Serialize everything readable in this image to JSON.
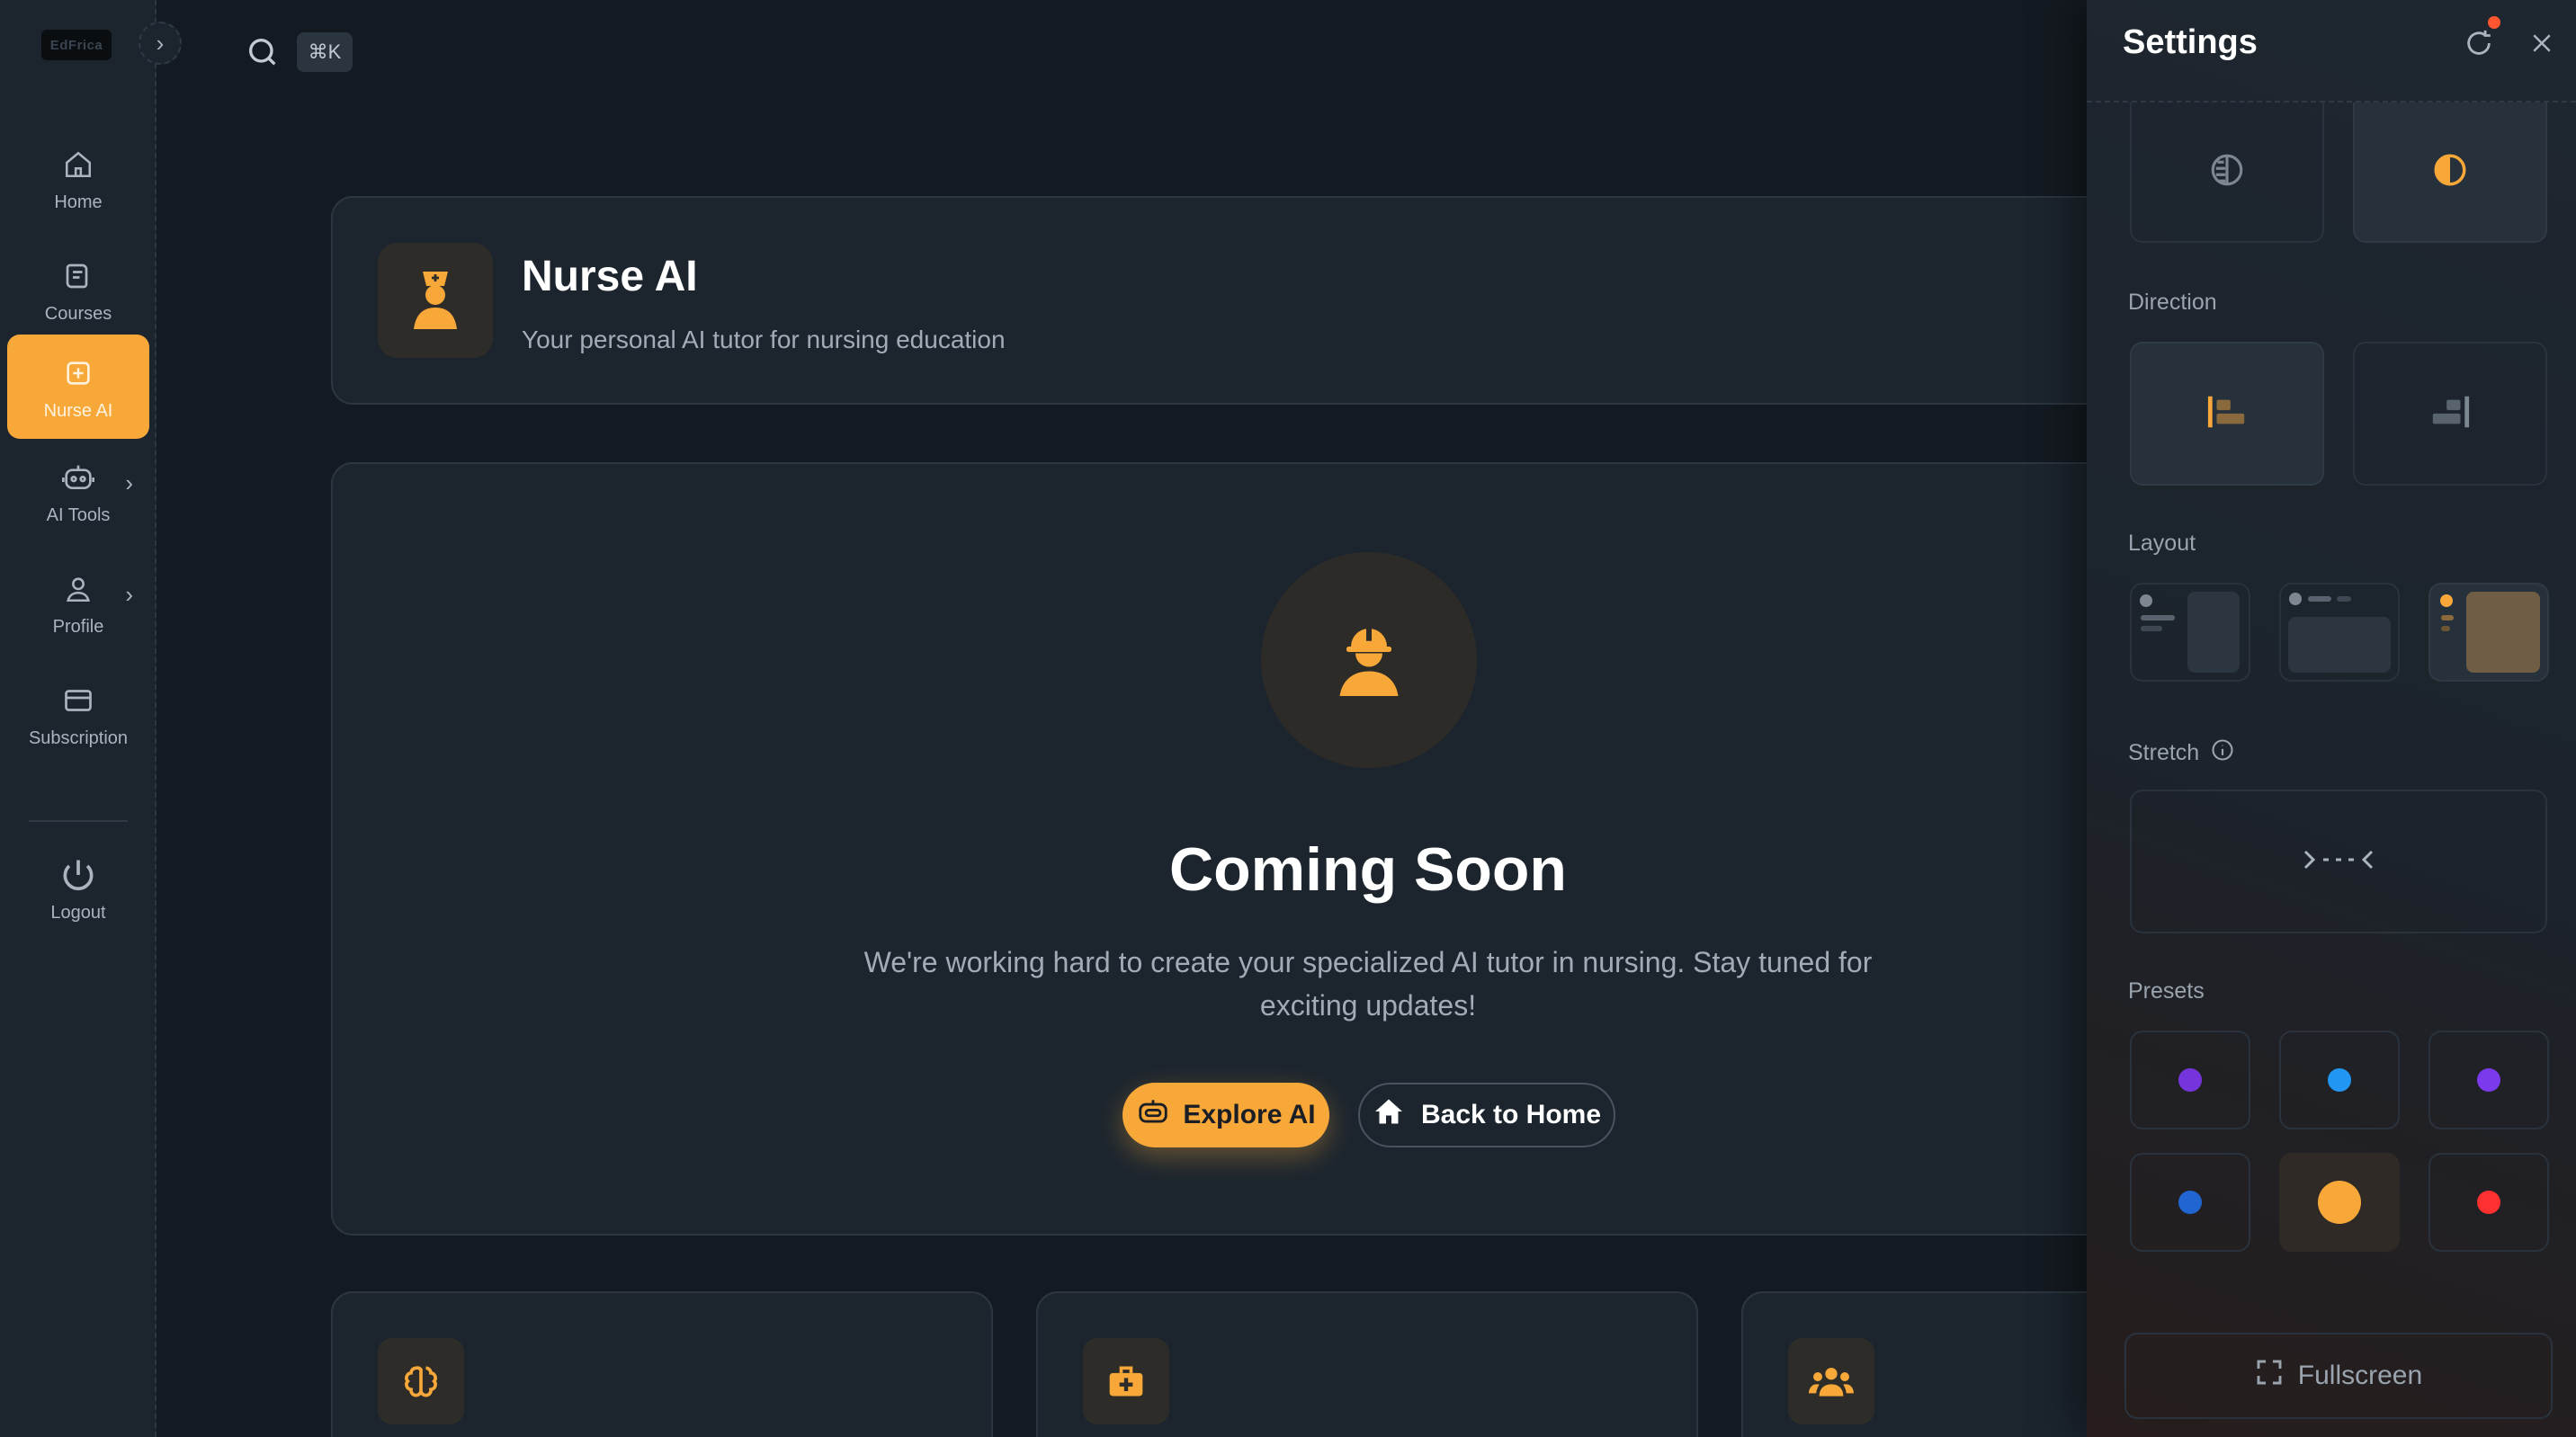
{
  "sidebar": {
    "logo_text": "EdFrica",
    "items": [
      {
        "label": "Home"
      },
      {
        "label": "Courses"
      },
      {
        "label": "Nurse AI"
      },
      {
        "label": "AI Tools"
      },
      {
        "label": "Profile"
      },
      {
        "label": "Subscription"
      },
      {
        "label": "Logout"
      }
    ]
  },
  "topbar": {
    "shortcut": "⌘K"
  },
  "header": {
    "title": "Nurse AI",
    "subtitle": "Your personal AI tutor for nursing education"
  },
  "main": {
    "title": "Coming Soon",
    "description": "We're working hard to create your specialized AI tutor in nursing. Stay tuned for exciting updates!",
    "explore_label": "Explore AI",
    "home_label": "Back to Home"
  },
  "settings": {
    "title": "Settings",
    "direction_label": "Direction",
    "layout_label": "Layout",
    "stretch_label": "Stretch",
    "presets_label": "Presets",
    "fullscreen_label": "Fullscreen",
    "preset_colors": [
      "#7635dc",
      "#2196f3",
      "#7c3aed",
      "#2065d1",
      "#f7a839",
      "#ff3030"
    ],
    "selected_preset": 4
  },
  "colors": {
    "accent": "#f7a839",
    "background": "#141a21",
    "surface": "#1c252e"
  }
}
